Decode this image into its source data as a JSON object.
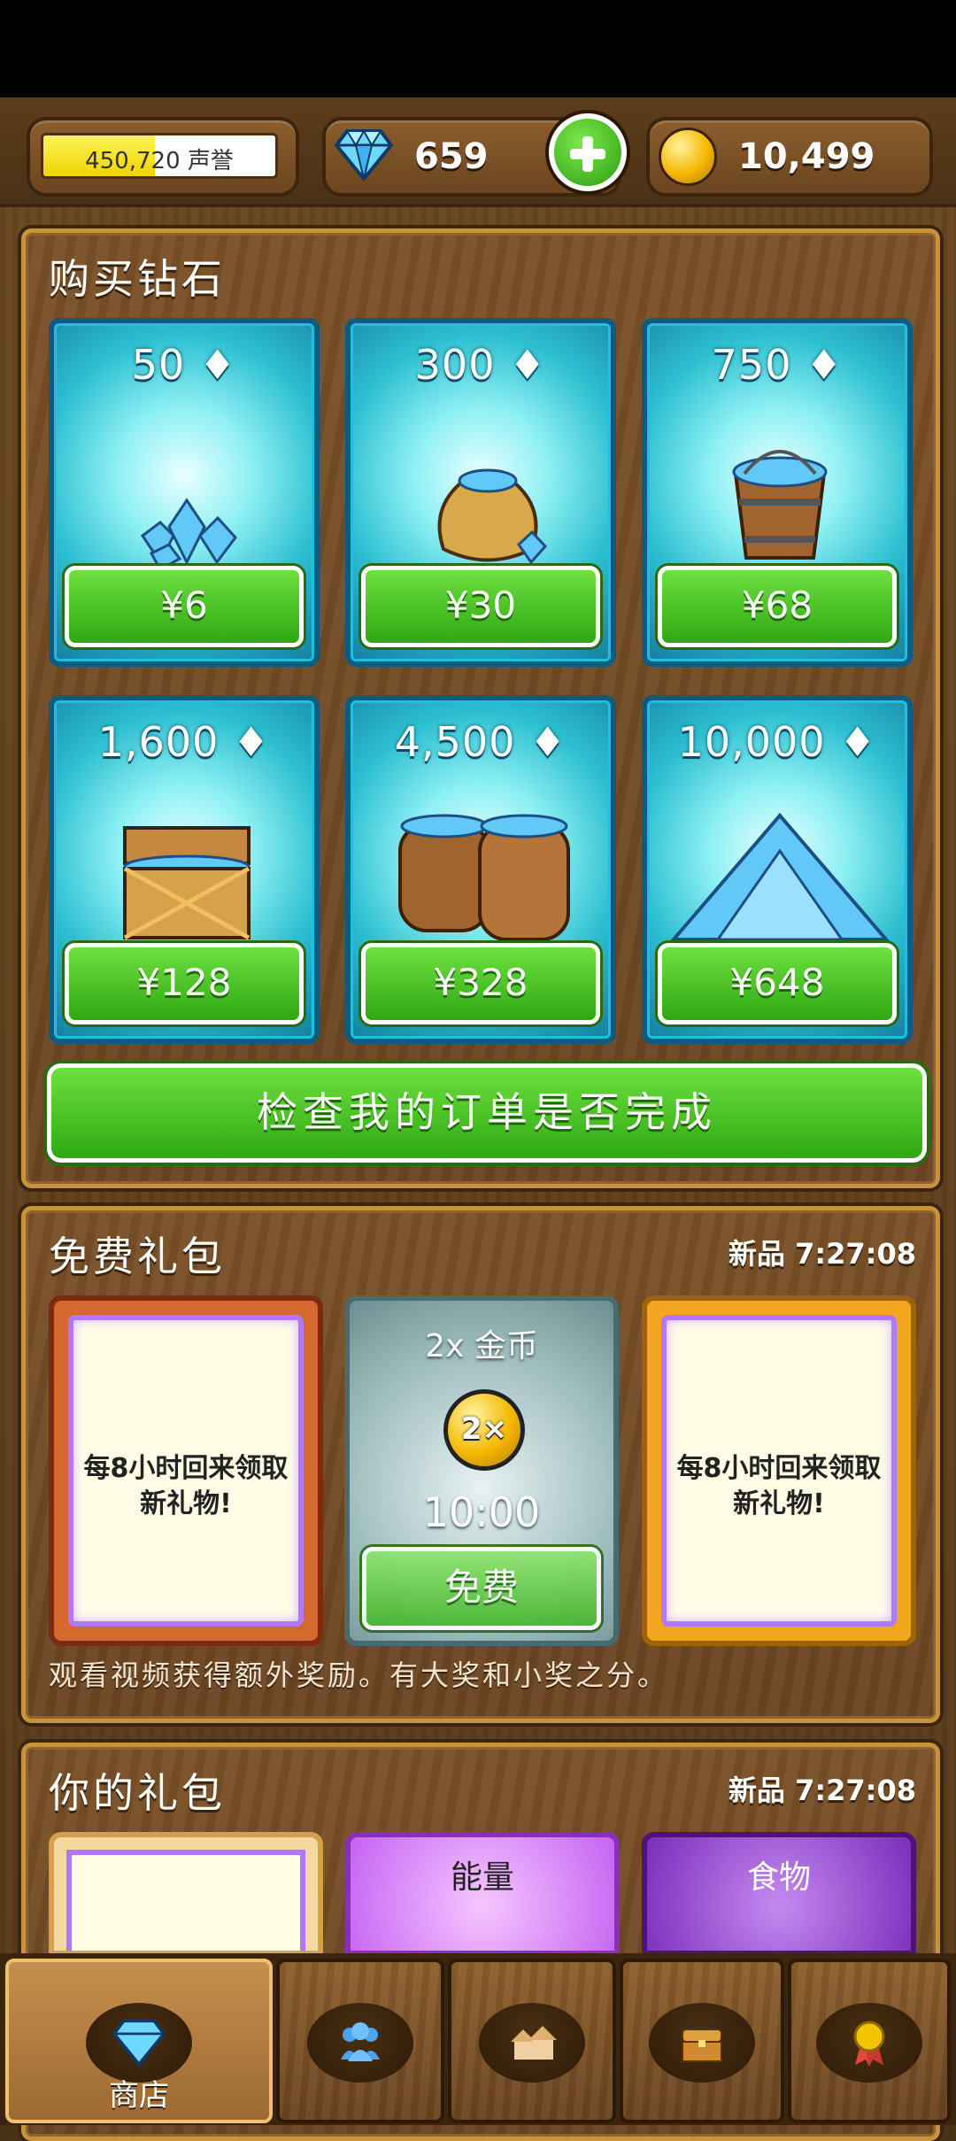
{
  "topbar": {
    "reputation_text": "450,720 声誉",
    "reputation_progress": 0.48,
    "diamonds": "659",
    "coins": "10,499"
  },
  "buy_diamonds": {
    "title": "购买钻石",
    "packs": [
      {
        "amount": "50",
        "price": "¥6",
        "item": "gem-pile-icon"
      },
      {
        "amount": "300",
        "price": "¥30",
        "item": "gem-sack-icon"
      },
      {
        "amount": "750",
        "price": "¥68",
        "item": "gem-bucket-icon"
      },
      {
        "amount": "1,600",
        "price": "¥128",
        "item": "gem-chest-icon"
      },
      {
        "amount": "4,500",
        "price": "¥328",
        "item": "gem-barrels-icon"
      },
      {
        "amount": "10,000",
        "price": "¥648",
        "item": "gem-mountain-icon"
      }
    ],
    "check_order_label": "检查我的订单是否完成"
  },
  "free_gifts": {
    "title": "免费礼包",
    "timer": "新品 7:27:08",
    "left_message": "每8小时回来领取新礼物!",
    "video_title": "2x 金币",
    "video_badge": "2×",
    "video_time": "10:00",
    "free_label": "免费",
    "right_message": "每8小时回来领取新礼物!",
    "footer": "观看视频获得额外奖励。有大奖和小奖之分。"
  },
  "your_gifts": {
    "title": "你的礼包",
    "timer": "新品 7:27:08",
    "cards": [
      {
        "label": ""
      },
      {
        "label": "能量"
      },
      {
        "label": "食物"
      }
    ]
  },
  "nav": {
    "tabs": [
      {
        "label": "商店",
        "icon": "gem-icon"
      },
      {
        "label": "",
        "icon": "people-icon"
      },
      {
        "label": "",
        "icon": "houses-icon"
      },
      {
        "label": "",
        "icon": "treasure-chest-icon"
      },
      {
        "label": "",
        "icon": "medal-icon"
      }
    ]
  },
  "colors": {
    "wood": "#6b4522",
    "accent_green": "#2ea812",
    "card_cyan": "#2cbfd0",
    "gold_border": "#c9933a"
  }
}
